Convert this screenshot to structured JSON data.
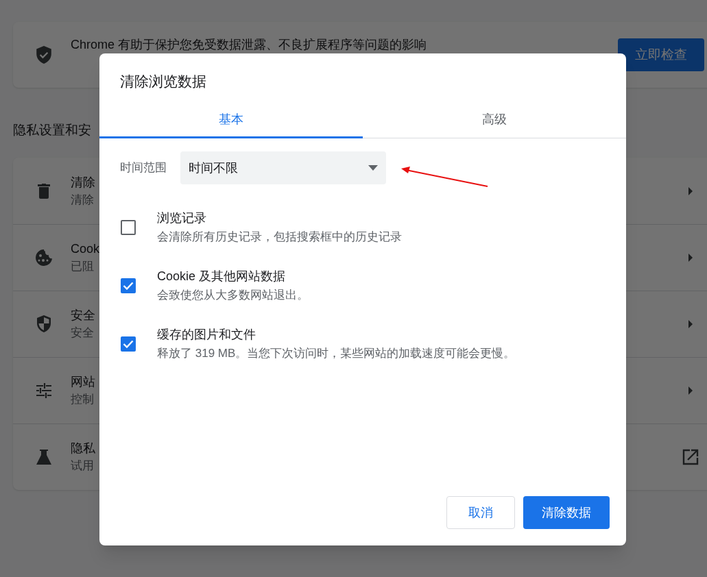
{
  "background_page": {
    "safety_check": {
      "text": "Chrome 有助于保护您免受数据泄露、不良扩展程序等问题的影响",
      "button": "立即检查"
    },
    "section_title": "隐私设置和安",
    "items": [
      {
        "title": "清除",
        "subtitle": "清除",
        "kind": "arrow"
      },
      {
        "title": "Cook",
        "subtitle": "已阻",
        "kind": "arrow"
      },
      {
        "title": "安全",
        "subtitle": "安全",
        "kind": "arrow"
      },
      {
        "title": "网站",
        "subtitle": "控制",
        "kind": "arrow"
      },
      {
        "title": "隐私",
        "subtitle": "试用",
        "kind": "external"
      }
    ]
  },
  "dialog": {
    "title": "清除浏览数据",
    "tabs": [
      {
        "label": "基本",
        "selected": true
      },
      {
        "label": "高级",
        "selected": false
      }
    ],
    "time_range": {
      "label": "时间范围",
      "value": "时间不限"
    },
    "options": [
      {
        "title": "浏览记录",
        "subtitle": "会清除所有历史记录，包括搜索框中的历史记录",
        "checked": false
      },
      {
        "title": "Cookie 及其他网站数据",
        "subtitle": "会致使您从大多数网站退出。",
        "checked": true
      },
      {
        "title": "缓存的图片和文件",
        "subtitle": "释放了 319 MB。当您下次访问时，某些网站的加载速度可能会更慢。",
        "checked": true
      }
    ],
    "buttons": {
      "cancel": "取消",
      "confirm": "清除数据"
    }
  }
}
